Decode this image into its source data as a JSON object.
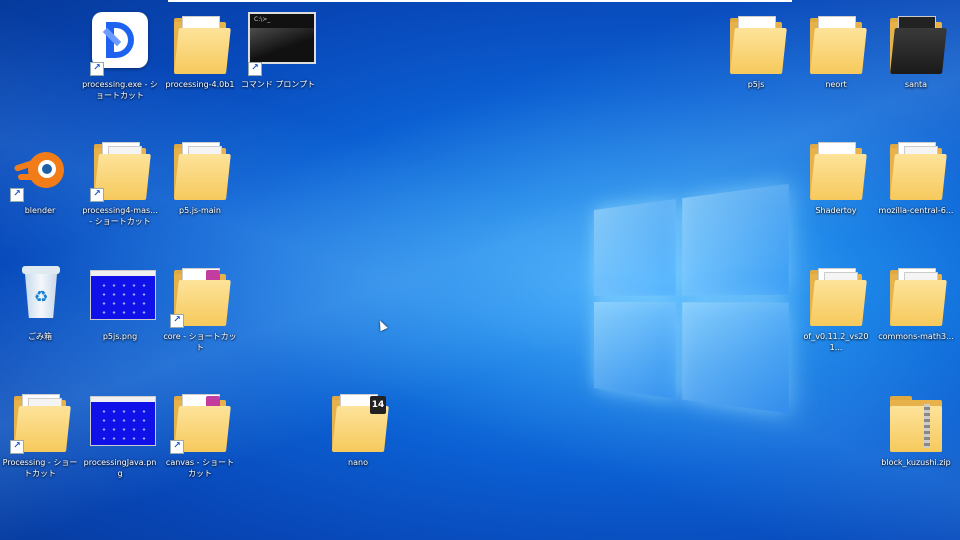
{
  "desktop": {
    "icons": [
      {
        "label": "processing.exe - ショートカット",
        "icon": "processing-app-icon"
      },
      {
        "label": "processing-4.0b1",
        "icon": "folder-icon"
      },
      {
        "label": "コマンド プロンプト",
        "icon": "terminal-icon"
      },
      {
        "label": "blender",
        "icon": "blender-icon"
      },
      {
        "label": "processing4-mas... - ショートカット",
        "icon": "folder-icon"
      },
      {
        "label": "p5.js-main",
        "icon": "folder-icon"
      },
      {
        "label": "ごみ箱",
        "icon": "recycle-bin-icon"
      },
      {
        "label": "p5js.png",
        "icon": "image-icon"
      },
      {
        "label": "core - ショートカット",
        "icon": "folder-icon"
      },
      {
        "label": "Processing - ショートカット",
        "icon": "folder-icon"
      },
      {
        "label": "processingJava.png",
        "icon": "image-icon"
      },
      {
        "label": "canvas - ショートカット",
        "icon": "folder-icon"
      },
      {
        "label": "nano",
        "icon": "folder-icon",
        "badge": "14"
      },
      {
        "label": "p5js",
        "icon": "folder-icon"
      },
      {
        "label": "neort",
        "icon": "folder-icon"
      },
      {
        "label": "santa",
        "icon": "folder-icon"
      },
      {
        "label": "Shadertoy",
        "icon": "folder-icon"
      },
      {
        "label": "mozilla-central-6...",
        "icon": "folder-icon"
      },
      {
        "label": "of_v0.11.2_vs201...",
        "icon": "folder-icon"
      },
      {
        "label": "commons-math3...",
        "icon": "folder-icon"
      },
      {
        "label": "block_kuzushi.zip",
        "icon": "zip-folder-icon"
      }
    ],
    "shortcut_arrow": "↗",
    "terminal_text": "C:\\>_",
    "recycle_symbol": "♻"
  },
  "colors": {
    "accent": "#1e63f0",
    "folder": "#f6c95c",
    "blender": "#f27c17"
  }
}
